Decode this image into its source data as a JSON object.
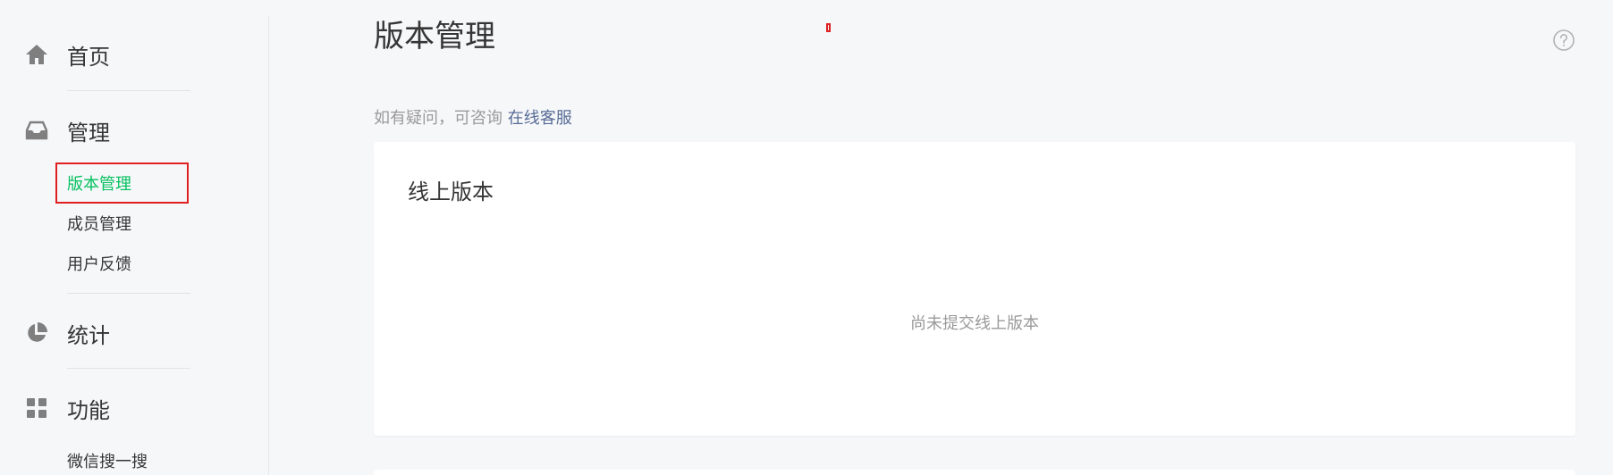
{
  "sidebar": {
    "home": {
      "label": "首页",
      "icon": "home-icon"
    },
    "manage": {
      "label": "管理",
      "icon": "inbox-icon",
      "items": [
        {
          "label": "版本管理",
          "active": true
        },
        {
          "label": "成员管理"
        },
        {
          "label": "用户反馈"
        }
      ]
    },
    "stats": {
      "label": "统计",
      "icon": "pie-chart-icon"
    },
    "features": {
      "label": "功能",
      "icon": "grid-icon",
      "items": [
        {
          "label": "微信搜一搜"
        }
      ]
    }
  },
  "main": {
    "title": "版本管理",
    "notice_prefix": "如有疑问，可咨询",
    "notice_link": "在线客服",
    "online_card": {
      "title": "线上版本",
      "empty_text": "尚未提交线上版本"
    }
  },
  "colors": {
    "accent": "#07c160",
    "link": "#576b95",
    "highlight": "#e02020"
  }
}
